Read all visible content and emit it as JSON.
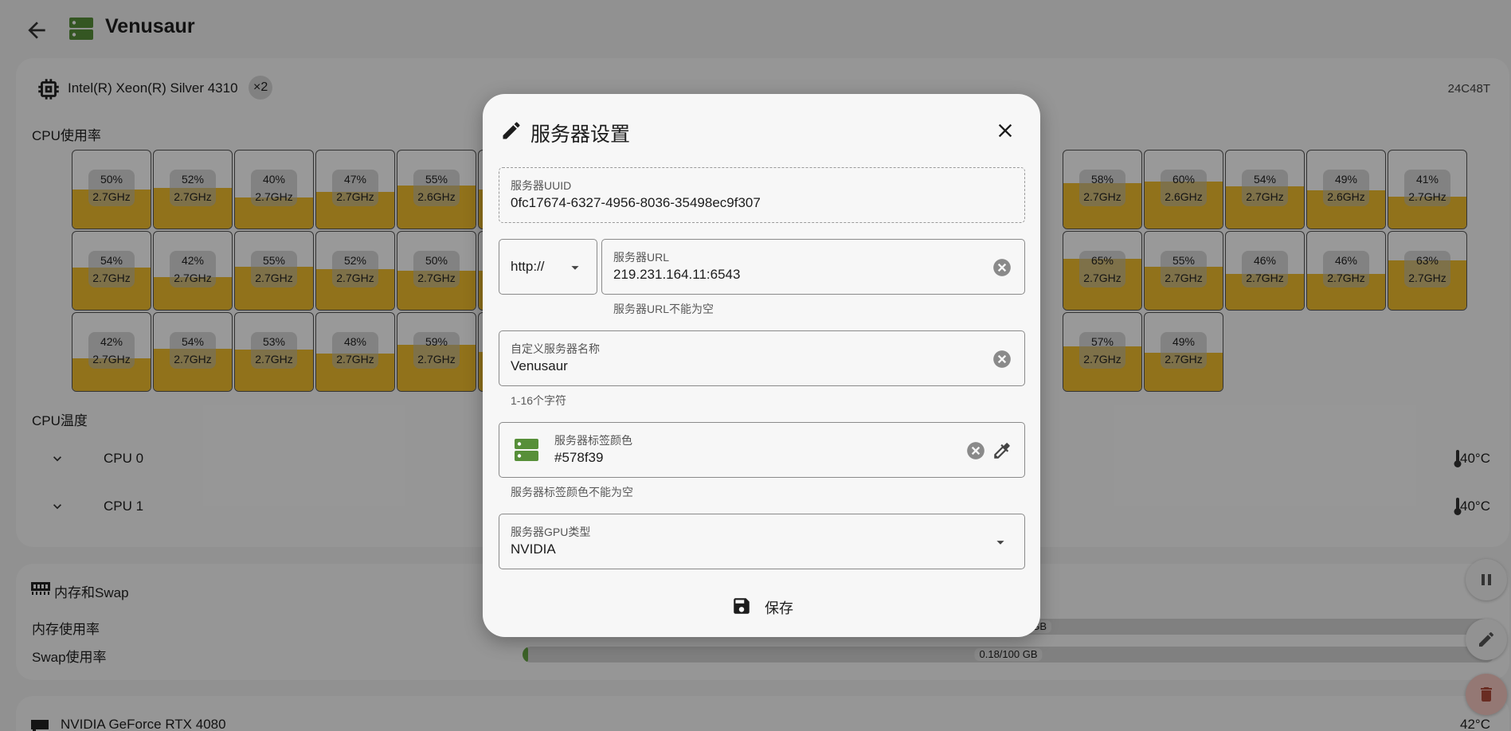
{
  "app": {
    "title": "Venusaur",
    "accent_color": "#578f39",
    "icons": {
      "back": "arrow-left-icon",
      "server": "server-icon"
    }
  },
  "cpu": {
    "model": "Intel(R) Xeon(R) Silver 4310",
    "count": "×2",
    "spec": "24C48T",
    "usage_label": "CPU使用率",
    "temp_label": "CPU温度",
    "cores_visible": [
      {
        "usage": "50%",
        "freq": "2.7GHz",
        "pct": 50
      },
      {
        "usage": "52%",
        "freq": "2.7GHz",
        "pct": 52
      },
      {
        "usage": "40%",
        "freq": "2.7GHz",
        "pct": 40
      },
      {
        "usage": "47%",
        "freq": "2.7GHz",
        "pct": 47
      },
      {
        "usage": "55%",
        "freq": "2.6GHz",
        "pct": 55
      },
      {
        "usage": "58%",
        "freq": "2.7GHz",
        "pct": 58
      },
      {
        "usage": "60%",
        "freq": "2.6GHz",
        "pct": 60
      },
      {
        "usage": "54%",
        "freq": "2.7GHz",
        "pct": 54
      },
      {
        "usage": "49%",
        "freq": "2.6GHz",
        "pct": 49
      },
      {
        "usage": "41%",
        "freq": "2.7GHz",
        "pct": 41
      },
      {
        "usage": "54%",
        "freq": "2.7GHz",
        "pct": 54
      },
      {
        "usage": "42%",
        "freq": "2.7GHz",
        "pct": 42
      },
      {
        "usage": "55%",
        "freq": "2.7GHz",
        "pct": 55
      },
      {
        "usage": "52%",
        "freq": "2.7GHz",
        "pct": 52
      },
      {
        "usage": "50%",
        "freq": "2.7GHz",
        "pct": 50
      },
      {
        "usage": "65%",
        "freq": "2.7GHz",
        "pct": 65
      },
      {
        "usage": "55%",
        "freq": "2.7GHz",
        "pct": 55
      },
      {
        "usage": "46%",
        "freq": "2.7GHz",
        "pct": 46
      },
      {
        "usage": "46%",
        "freq": "2.7GHz",
        "pct": 46
      },
      {
        "usage": "63%",
        "freq": "2.7GHz",
        "pct": 63
      },
      {
        "usage": "42%",
        "freq": "2.7GHz",
        "pct": 42
      },
      {
        "usage": "54%",
        "freq": "2.7GHz",
        "pct": 54
      },
      {
        "usage": "53%",
        "freq": "2.7GHz",
        "pct": 53
      },
      {
        "usage": "48%",
        "freq": "2.7GHz",
        "pct": 48
      },
      {
        "usage": "59%",
        "freq": "2.7GHz",
        "pct": 59
      },
      {
        "usage": "57%",
        "freq": "2.7GHz",
        "pct": 57
      },
      {
        "usage": "49%",
        "freq": "2.7GHz",
        "pct": 49
      }
    ],
    "temps": [
      {
        "name": "CPU 0",
        "value": "40°C"
      },
      {
        "name": "CPU 1",
        "value": "40°C"
      }
    ]
  },
  "memory": {
    "title": "内存和Swap",
    "mem_label": "内存使用率",
    "mem_text": "GB",
    "swap_label": "Swap使用率",
    "swap_text": "0.18/100 GB",
    "swap_fraction": 0.0018
  },
  "gpu": {
    "name": "NVIDIA GeForce RTX 4080",
    "temp": "42°C"
  },
  "dialog": {
    "title": "服务器设置",
    "uuid_label": "服务器UUID",
    "uuid_value": "0fc17674-6327-4956-8036-35498ec9f307",
    "protocol_value": "http://",
    "url_label": "服务器URL",
    "url_value": "219.231.164.11:6543",
    "url_helper": "服务器URL不能为空",
    "name_label": "自定义服务器名称",
    "name_value": "Venusaur",
    "name_helper": "1-16个字符",
    "color_label": "服务器标签颜色",
    "color_value": "#578f39",
    "color_helper": "服务器标签颜色不能为空",
    "gpu_label": "服务器GPU类型",
    "gpu_value": "NVIDIA",
    "save_label": "保存"
  }
}
